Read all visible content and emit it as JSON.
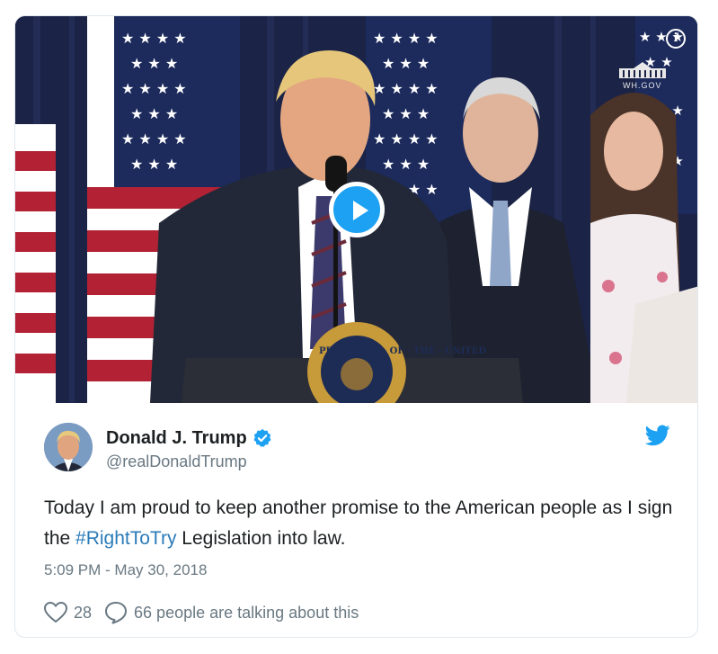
{
  "media": {
    "info_icon": "info-icon",
    "play_icon": "play-icon",
    "watermark_text": "WH.GOV"
  },
  "author": {
    "name": "Donald J. Trump",
    "handle": "@realDonaldTrump",
    "verified_icon": "verified-badge-icon",
    "avatar_icon": "avatar"
  },
  "tweet": {
    "text_before": "Today I am proud to keep another promise to the American people as I sign the ",
    "hashtag": "#RightToTry",
    "text_after": " Legislation into law.",
    "timestamp": "5:09 PM - May 30, 2018"
  },
  "actions": {
    "likes": "28",
    "talking": "66 people are talking about this"
  },
  "colors": {
    "accent": "#1da1f2",
    "hashtag": "#2b7bb9",
    "secondary_text": "#697882"
  }
}
